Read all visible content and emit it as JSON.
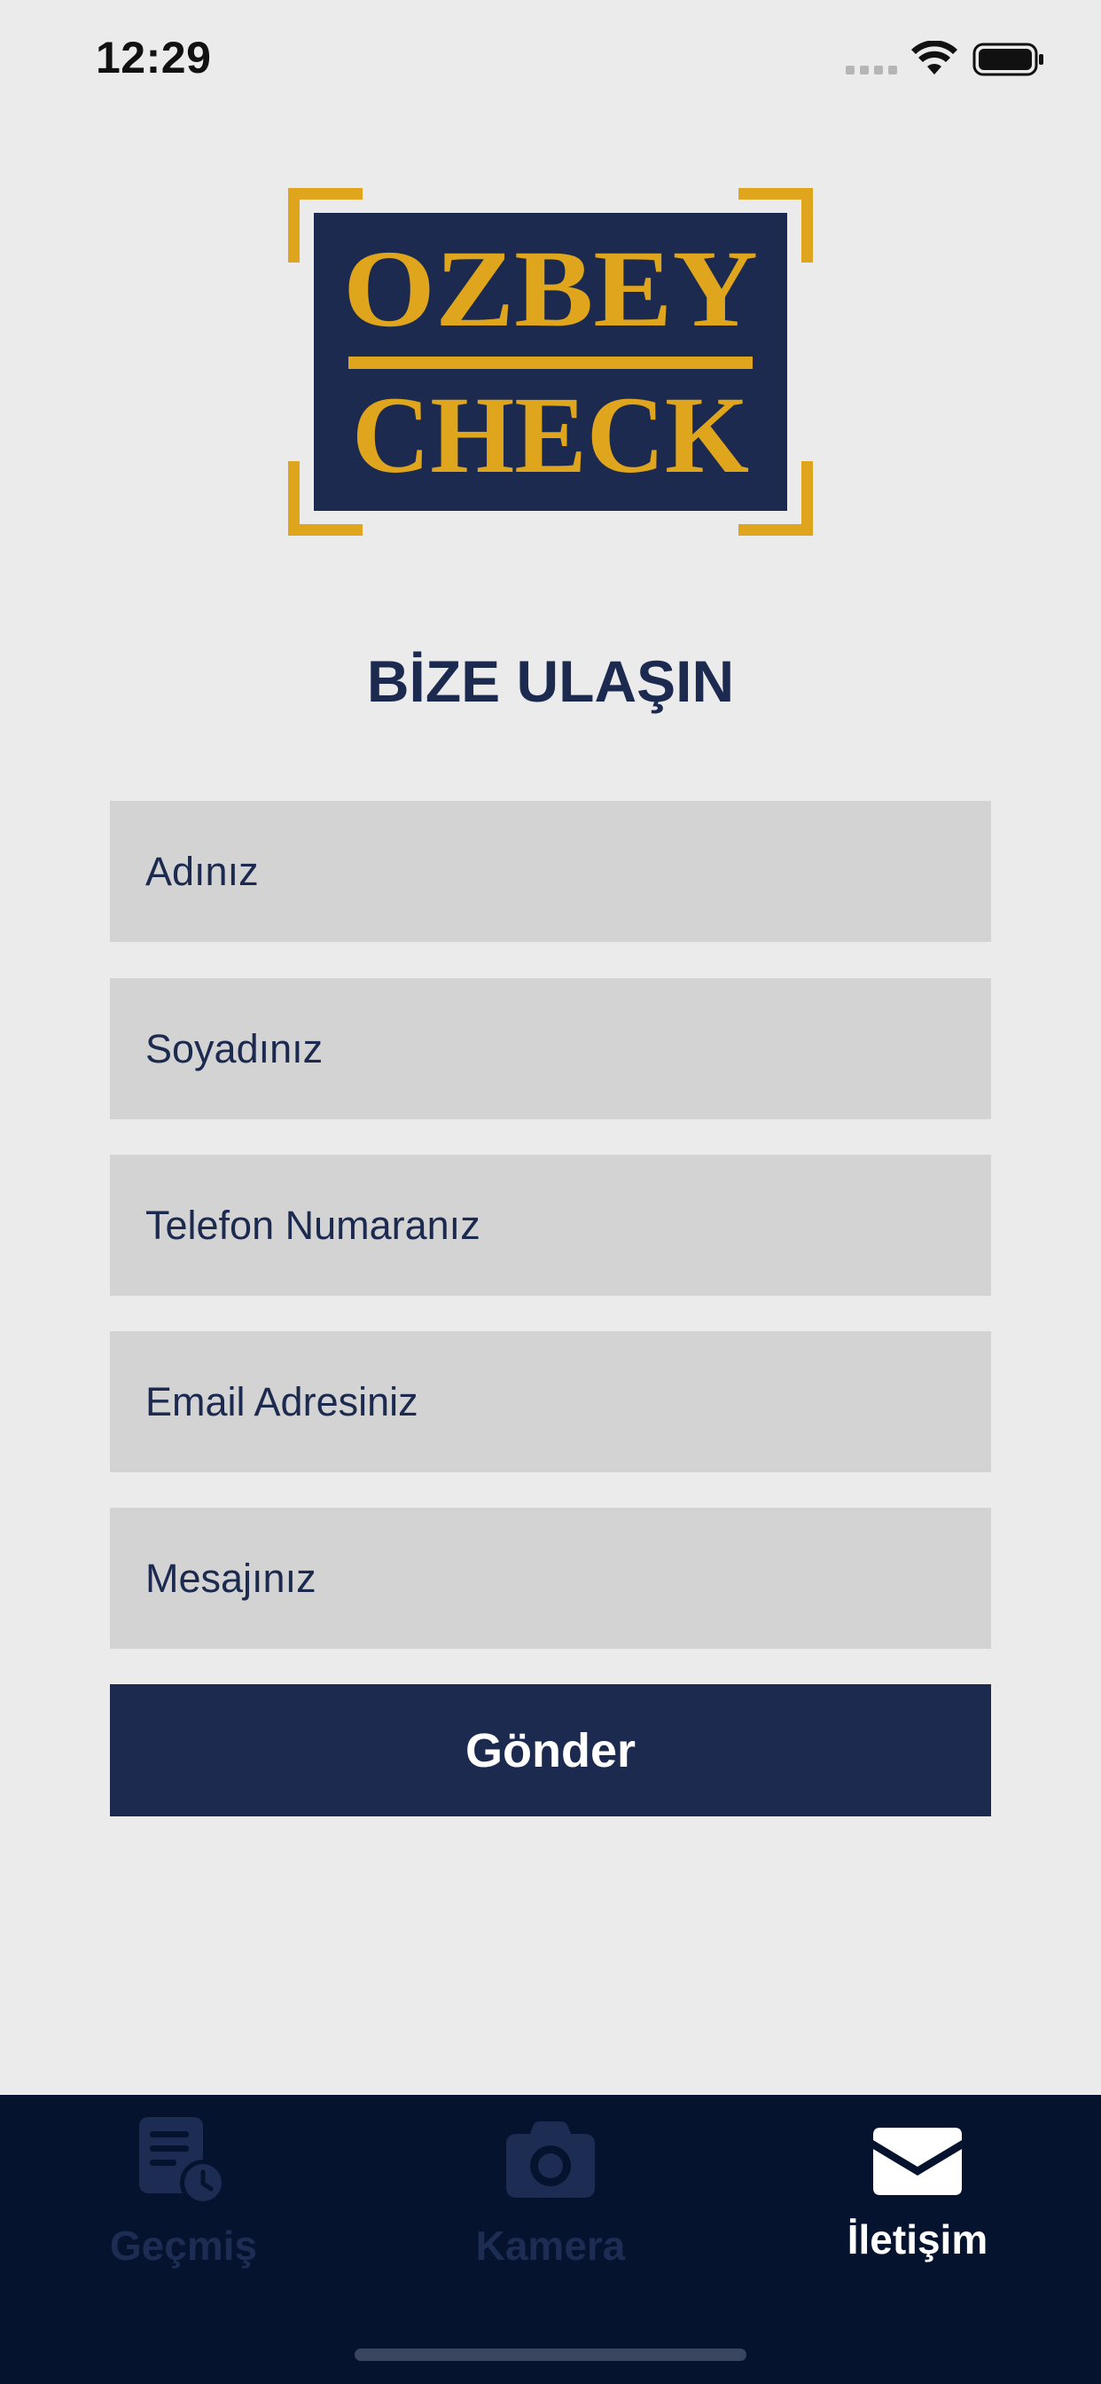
{
  "status_bar": {
    "time": "12:29"
  },
  "logo": {
    "line1": "OZBEY",
    "line2": "CHECK",
    "colors": {
      "navy": "#1b2a4e",
      "gold": "#dfa51c"
    }
  },
  "page": {
    "title": "BİZE ULAŞIN"
  },
  "form": {
    "fields": [
      {
        "placeholder": "Adınız"
      },
      {
        "placeholder": "Soyadınız"
      },
      {
        "placeholder": "Telefon Numaranız"
      },
      {
        "placeholder": "Email Adresiniz"
      },
      {
        "placeholder": "Mesajınız"
      }
    ],
    "submit_label": "Gönder"
  },
  "tab_bar": {
    "tabs": [
      {
        "label": "Geçmiş",
        "icon": "history-document-icon",
        "active": false
      },
      {
        "label": "Kamera",
        "icon": "camera-icon",
        "active": false
      },
      {
        "label": "İletişim",
        "icon": "envelope-icon",
        "active": true
      }
    ]
  },
  "colors": {
    "background": "#ebebeb",
    "field": "#d3d3d3",
    "primary": "#1b2a4e",
    "tab_bar": "#05132f",
    "tab_inactive": "#1d2c52"
  }
}
